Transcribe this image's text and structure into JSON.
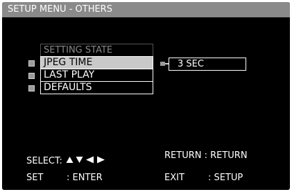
{
  "title": "SETUP MENU - OTHERS",
  "menu": {
    "header": "SETTING STATE",
    "items": [
      {
        "label": "JPEG TIME",
        "selected": true
      },
      {
        "label": "LAST PLAY",
        "selected": false
      },
      {
        "label": "DEFAULTS",
        "selected": false
      }
    ]
  },
  "value": "3 SEC",
  "footer": {
    "select_label": "SELECT:",
    "return_label": "RETURN : RETURN",
    "set_label": "SET",
    "set_value": ": ENTER",
    "exit_label": "EXIT",
    "exit_value": ": SETUP"
  },
  "colors": {
    "background": "#000000",
    "title_bar": "#8a8a8a",
    "selected_item": "#c9c9c9",
    "text": "#ffffff"
  },
  "icons": [
    "up-arrow-icon",
    "down-arrow-icon",
    "left-arrow-icon",
    "right-arrow-icon"
  ]
}
